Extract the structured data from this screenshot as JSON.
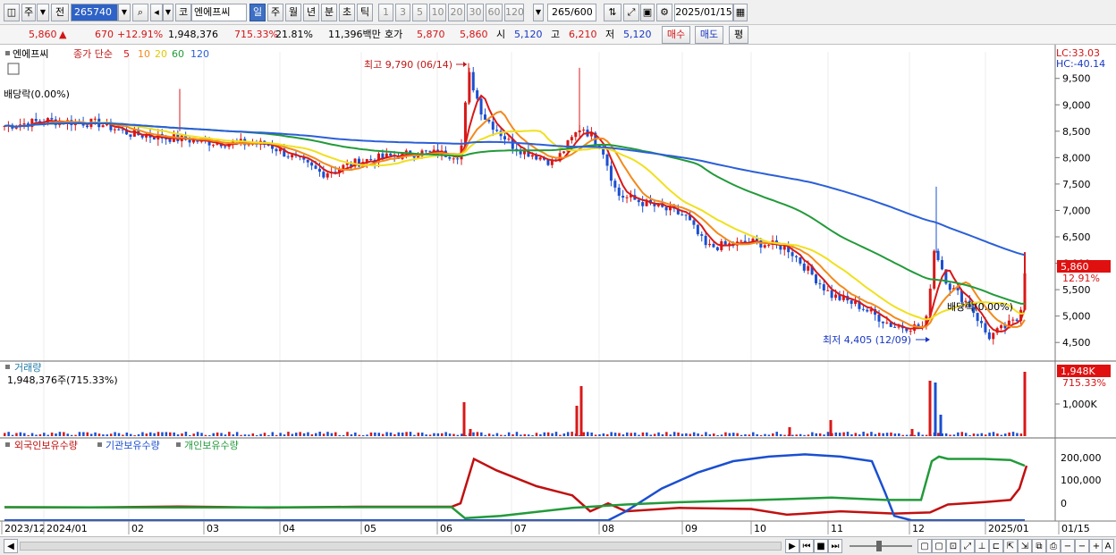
{
  "toolbar": {
    "stock_type": "주",
    "prev_label": "전",
    "code": "265740",
    "market_label": "코",
    "stock_name": "엔에프씨",
    "periods": [
      "일",
      "주",
      "월",
      "년",
      "분",
      "초",
      "틱"
    ],
    "active_period": "일",
    "intervals": [
      "1",
      "3",
      "5",
      "10",
      "20",
      "30",
      "60",
      "120"
    ],
    "count": "265",
    "count_total": "/600",
    "date": "2025/01/15"
  },
  "info": {
    "price": "5,860",
    "change_arrow": "▲",
    "change": "670",
    "change_pct": "+12.91%",
    "volume": "1,948,376",
    "volume_ratio": "715.33%",
    "turnover": "21.81%",
    "amount": "11,396백만",
    "ask_label": "호가",
    "ask": "5,870",
    "bid": "5,860",
    "open_label": "시",
    "open": "5,120",
    "high_label": "고",
    "high": "6,210",
    "low_label": "저",
    "low": "5,120",
    "buy_button": "매수",
    "sell_button": "매도",
    "eval_button": "평"
  },
  "price_panel": {
    "name": "엔에프씨",
    "legend_main": "종가 단순",
    "ma": [
      {
        "period": "5",
        "color": "#d81818"
      },
      {
        "period": "10",
        "color": "#f28a1c"
      },
      {
        "period": "20",
        "color": "#f0e01e"
      },
      {
        "period": "60",
        "color": "#229a3a"
      },
      {
        "period": "120",
        "color": "#2b5fd8"
      }
    ],
    "dividend_label": "배당락(0.00%)",
    "dividend_label_right": "배당락(0.00%)",
    "high_annotation": "최고 9,790 (06/14)",
    "low_annotation": "최저 4,405 (12/09)",
    "lc": "LC:33.03",
    "hc": "HC:-40.14",
    "last_price_tag": "5,860",
    "last_change_tag": "12.91%",
    "y_ticks": [
      "9,500",
      "9,000",
      "8,500",
      "8,000",
      "7,500",
      "7,000",
      "6,500",
      "6,000",
      "5,500",
      "5,000",
      "4,500"
    ]
  },
  "volume_panel": {
    "title": "거래량",
    "value": "1,948,376주(715.33%)",
    "tag": "1,948K",
    "tag_pct": "715.33%",
    "y_ticks": [
      "1,000K"
    ]
  },
  "holding_panel": {
    "legend": [
      {
        "label": "외국인보유수량",
        "color": "#c01010"
      },
      {
        "label": "기관보유수량",
        "color": "#1b4fd0"
      },
      {
        "label": "개인보유수량",
        "color": "#229a3a"
      }
    ],
    "y_ticks": [
      "200,000",
      "100,000",
      "0"
    ]
  },
  "x_axis": {
    "labels": [
      "2023/12",
      "2024/01",
      "02",
      "03",
      "04",
      "05",
      "06",
      "07",
      "08",
      "09",
      "10",
      "11",
      "12",
      "2025/01",
      "01/15"
    ]
  },
  "chart_data": {
    "type": "line",
    "title": "",
    "series": [
      {
        "name": "종가",
        "dates": [
          "2023/12",
          "2024/01",
          "02",
          "03",
          "04",
          "05",
          "06/14",
          "07",
          "08",
          "09",
          "10",
          "11",
          "12/09",
          "2025/01/15"
        ],
        "values": [
          8600,
          8700,
          8450,
          8300,
          8200,
          7700,
          9790,
          8200,
          8100,
          6300,
          6400,
          5300,
          4405,
          5860
        ]
      },
      {
        "name": "120",
        "dates": [
          "2023/12",
          "03",
          "06",
          "08",
          "10",
          "12",
          "2025/01/15"
        ],
        "values": [
          8450,
          8550,
          8400,
          8250,
          7600,
          6700,
          6100
        ]
      }
    ],
    "ylim": [
      4300,
      9800
    ],
    "grid": true
  }
}
